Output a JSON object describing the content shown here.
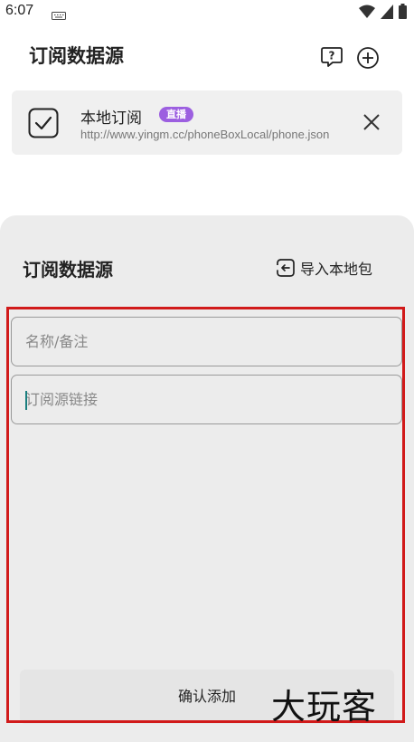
{
  "status_bar": {
    "time": "6:07",
    "icons": [
      "keyboard-icon",
      "wifi-icon",
      "signal-icon",
      "battery-icon"
    ]
  },
  "header": {
    "title": "订阅数据源",
    "actions": [
      "help-icon",
      "add-icon"
    ]
  },
  "subscription": {
    "name": "本地订阅",
    "badge": "直播",
    "url": "http://www.yingm.cc/phoneBoxLocal/phone.json",
    "checked": true
  },
  "sheet": {
    "title": "订阅数据源",
    "import_label": "导入本地包",
    "name_placeholder": "名称/备注",
    "url_placeholder": "订阅源链接",
    "confirm_label": "确认添加"
  },
  "watermark": "大玩客",
  "colors": {
    "badge": "#9c5fe0",
    "highlight": "#d11a1a",
    "cursor": "#1a7f7f"
  }
}
